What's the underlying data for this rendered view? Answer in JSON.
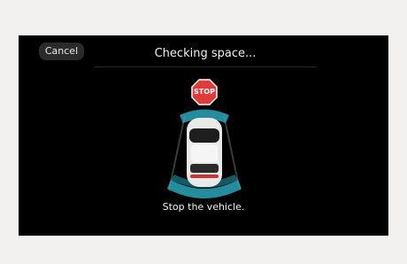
{
  "dialog": {
    "cancel_label": "Cancel",
    "title": "Checking space...",
    "stop_sign_text": "STOP",
    "message": "Stop the vehicle."
  },
  "colors": {
    "stop_sign": "#e03a3a",
    "sensor_zone": "#2aa6b9",
    "screen_bg": "#000000"
  }
}
